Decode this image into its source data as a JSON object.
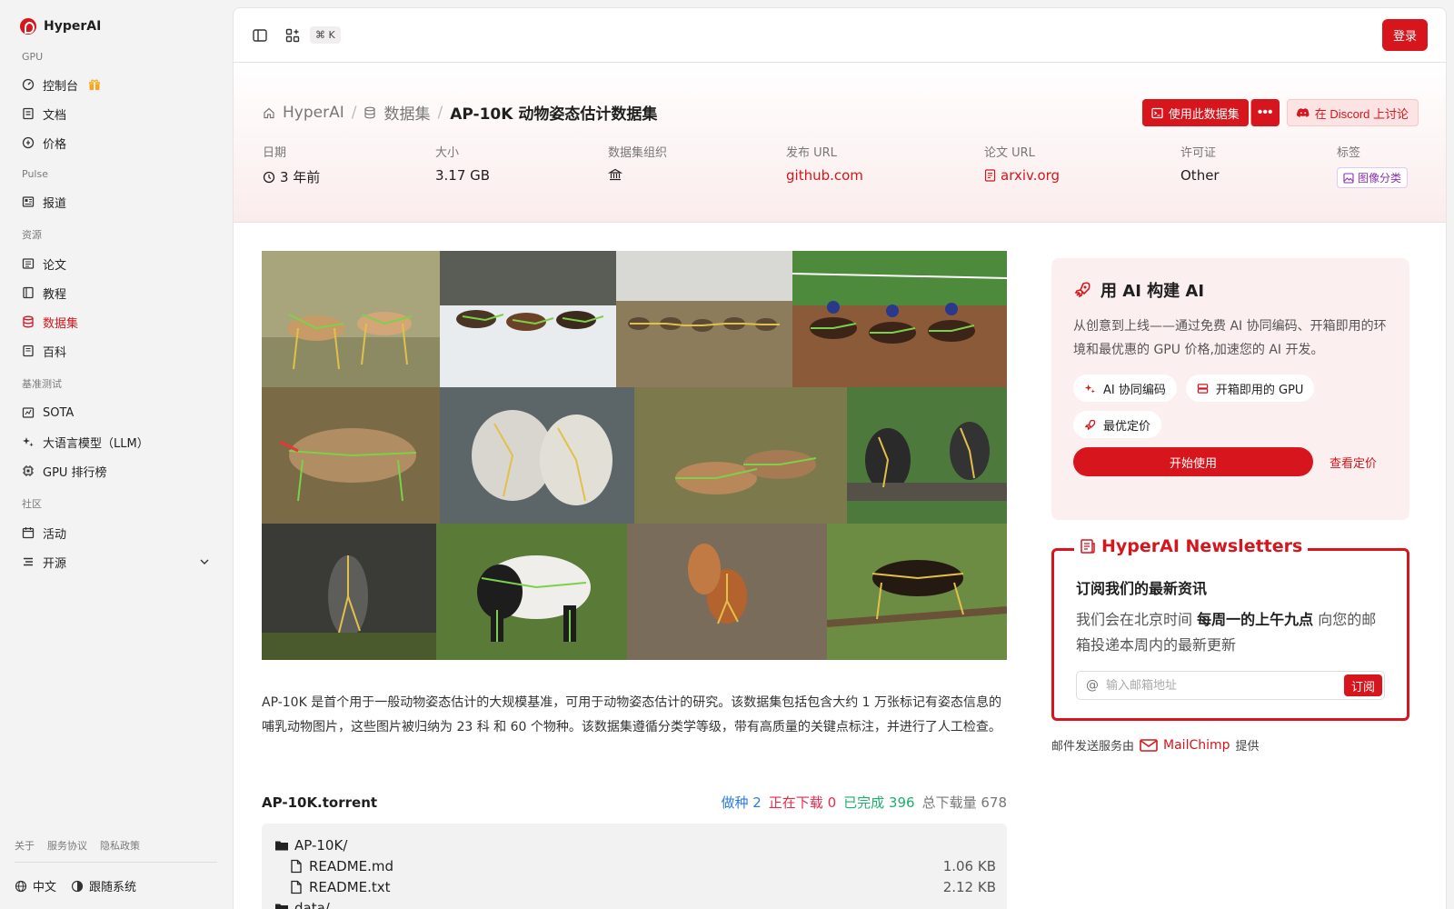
{
  "sidebar": {
    "brand": "HyperAI",
    "sections": [
      {
        "title": "GPU",
        "items": [
          {
            "label": "控制台",
            "icon": "gauge-icon"
          },
          {
            "label": "文档",
            "icon": "book-icon"
          },
          {
            "label": "价格",
            "icon": "price-icon"
          }
        ]
      },
      {
        "title": "Pulse",
        "items": [
          {
            "label": "报道",
            "icon": "news-icon"
          }
        ]
      },
      {
        "title": "资源",
        "items": [
          {
            "label": "论文",
            "icon": "paper-icon"
          },
          {
            "label": "教程",
            "icon": "tutorial-icon"
          },
          {
            "label": "数据集",
            "icon": "database-icon",
            "active": true
          },
          {
            "label": "百科",
            "icon": "wiki-icon"
          }
        ]
      },
      {
        "title": "基准测试",
        "items": [
          {
            "label": "SOTA",
            "icon": "trophy-icon"
          },
          {
            "label": "大语言模型（LLM）",
            "icon": "sparkle-icon"
          },
          {
            "label": "GPU 排行榜",
            "icon": "chip-icon"
          }
        ]
      },
      {
        "title": "社区",
        "items": [
          {
            "label": "活动",
            "icon": "calendar-icon"
          },
          {
            "label": "开源",
            "icon": "list-icon"
          }
        ]
      }
    ],
    "footer_links": [
      "关于",
      "服务协议",
      "隐私政策"
    ],
    "language": "中文",
    "theme": "跟随系统"
  },
  "topbar": {
    "shortcut": "⌘ K",
    "login": "登录"
  },
  "header": {
    "breadcrumb": [
      "HyperAI",
      "数据集",
      "AP-10K 动物姿态估计数据集"
    ],
    "actions": {
      "use_dataset": "使用此数据集",
      "more": "•••",
      "discord": "在 Discord 上讨论"
    },
    "meta": [
      {
        "label": "日期",
        "value": "3 年前"
      },
      {
        "label": "大小",
        "value": "3.17 GB"
      },
      {
        "label": "数据集组织",
        "value": ""
      },
      {
        "label": "发布 URL",
        "value": "github.com"
      },
      {
        "label": "论文 URL",
        "value": "arxiv.org"
      },
      {
        "label": "许可证",
        "value": "Other"
      },
      {
        "label": "标签",
        "value": "图像分类"
      }
    ]
  },
  "description": "AP-10K 是首个用于一般动物姿态估计的大规模基准，可用于动物姿态估计的研究。该数据集包括包含大约 1 万张标记有姿态信息的哺乳动物图片，这些图片被归纳为 23 科 和 60 个物种。该数据集遵循分类学等级，带有高质量的关键点标注，并进行了人工检查。",
  "torrent": {
    "name": "AP-10K.torrent",
    "seed_label": "做种",
    "seed": "2",
    "downloading_label": "正在下载",
    "downloading": "0",
    "completed_label": "已完成",
    "completed": "396",
    "total_label": "总下载量",
    "total": "678",
    "files": [
      {
        "name": "AP-10K/",
        "type": "folder",
        "size": ""
      },
      {
        "name": "README.md",
        "type": "file",
        "size": "1.06 KB"
      },
      {
        "name": "README.txt",
        "type": "file",
        "size": "2.12 KB"
      },
      {
        "name": "data/",
        "type": "folder",
        "size": ""
      }
    ]
  },
  "promo": {
    "title": "用 AI 构建 AI",
    "text": "从创意到上线——通过免费 AI 协同编码、开箱即用的环境和最优惠的 GPU 价格,加速您的 AI 开发。",
    "chips": [
      "AI 协同编码",
      "开箱即用的 GPU",
      "最优定价"
    ],
    "start": "开始使用",
    "pricing": "查看定价"
  },
  "newsletter": {
    "title": "HyperAI Newsletters",
    "heading": "订阅我们的最新资讯",
    "text_before": "我们会在北京时间 ",
    "text_bold": "每周一的上午九点",
    "text_after": " 向您的邮箱投递本周内的最新更新",
    "placeholder": "输入邮箱地址",
    "subscribe": "订阅"
  },
  "mail_credit": {
    "before": "邮件发送服务由",
    "provider": "MailChimp",
    "after": "提供"
  },
  "colors": {
    "accent": "#d7151c"
  }
}
